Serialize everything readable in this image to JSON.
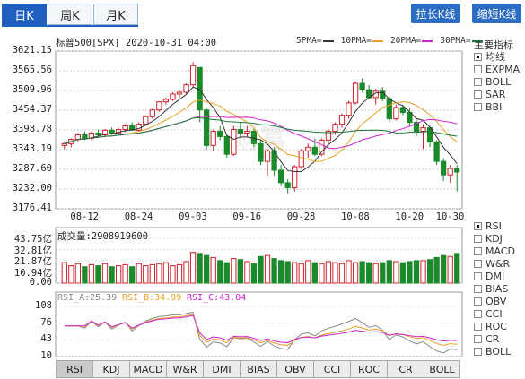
{
  "tabs": [
    {
      "label": "日K",
      "active": true
    },
    {
      "label": "周K",
      "active": false
    },
    {
      "label": "月K",
      "active": false
    }
  ],
  "buttons": {
    "stretch": "拉长K线",
    "shrink": "缩短K线"
  },
  "title": "标普500[SPX] 2020-10-31 04:00",
  "legend": [
    {
      "label": "5PMA=",
      "color": "#333333"
    },
    {
      "label": "10PMA=",
      "color": "#e8a020"
    },
    {
      "label": "20PMA=",
      "color": "#d020d0"
    },
    {
      "label": "30PMA=",
      "color": "#1a7a3a"
    }
  ],
  "side_main_title": "主要指标",
  "side_main": [
    {
      "label": "均线",
      "checked": true
    },
    {
      "label": "EXPMA",
      "checked": false
    },
    {
      "label": "BOLL",
      "checked": false
    },
    {
      "label": "SAR",
      "checked": false
    },
    {
      "label": "BBI",
      "checked": false
    }
  ],
  "side_sub": [
    {
      "label": "RSI",
      "checked": true
    },
    {
      "label": "KDJ",
      "checked": false
    },
    {
      "label": "MACD",
      "checked": false
    },
    {
      "label": "W&R",
      "checked": false
    },
    {
      "label": "DMI",
      "checked": false
    },
    {
      "label": "BIAS",
      "checked": false
    },
    {
      "label": "OBV",
      "checked": false
    },
    {
      "label": "CCI",
      "checked": false
    },
    {
      "label": "ROC",
      "checked": false
    },
    {
      "label": "CR",
      "checked": false
    },
    {
      "label": "BOLL",
      "checked": false
    }
  ],
  "volume_label": "成交量:2908919600",
  "rsi_label": {
    "a": "RSI_A:25.39",
    "b": "RSI_B:34.99",
    "c": "RSI_C:43.04"
  },
  "bottom_tabs": [
    "RSI",
    "KDJ",
    "MACD",
    "W&R",
    "DMI",
    "BIAS",
    "OBV",
    "CCI",
    "ROC",
    "CR",
    "BOLL"
  ],
  "watermark": "财富",
  "colors": {
    "up": "#d0202a",
    "down": "#1a8a2a",
    "ma5": "#333333",
    "ma10": "#e8a020",
    "ma20": "#d020d0",
    "ma30": "#1a7a3a"
  },
  "chart_data": [
    {
      "type": "candlestick",
      "title": "标普500[SPX] 2020-10-31 04:00",
      "y_ticks": [
        "3621.15",
        "3565.56",
        "3509.96",
        "3454.37",
        "3398.78",
        "3343.19",
        "3287.60",
        "3232.00",
        "3176.41"
      ],
      "ylim": [
        3176.41,
        3621.15
      ],
      "x_ticks": [
        "08-12",
        "08-24",
        "09-03",
        "09-16",
        "09-28",
        "10-08",
        "10-20",
        "10-30"
      ],
      "ohlc": [
        [
          3355,
          3365,
          3345,
          3360
        ],
        [
          3360,
          3375,
          3350,
          3372
        ],
        [
          3372,
          3390,
          3365,
          3385
        ],
        [
          3385,
          3395,
          3370,
          3375
        ],
        [
          3375,
          3395,
          3370,
          3390
        ],
        [
          3390,
          3400,
          3380,
          3385
        ],
        [
          3385,
          3402,
          3378,
          3398
        ],
        [
          3398,
          3405,
          3385,
          3390
        ],
        [
          3390,
          3405,
          3385,
          3400
        ],
        [
          3400,
          3415,
          3392,
          3410
        ],
        [
          3410,
          3420,
          3400,
          3398
        ],
        [
          3398,
          3420,
          3395,
          3415
        ],
        [
          3415,
          3440,
          3410,
          3436
        ],
        [
          3436,
          3460,
          3430,
          3455
        ],
        [
          3455,
          3480,
          3450,
          3478
        ],
        [
          3478,
          3490,
          3470,
          3485
        ],
        [
          3485,
          3505,
          3480,
          3500
        ],
        [
          3500,
          3510,
          3490,
          3505
        ],
        [
          3505,
          3530,
          3500,
          3526
        ],
        [
          3526,
          3590,
          3520,
          3580
        ],
        [
          3575,
          3576,
          3420,
          3455
        ],
        [
          3455,
          3460,
          3345,
          3355
        ],
        [
          3355,
          3400,
          3340,
          3395
        ],
        [
          3395,
          3410,
          3370,
          3380
        ],
        [
          3380,
          3385,
          3320,
          3330
        ],
        [
          3330,
          3410,
          3325,
          3400
        ],
        [
          3400,
          3420,
          3375,
          3390
        ],
        [
          3390,
          3410,
          3380,
          3395
        ],
        [
          3395,
          3405,
          3350,
          3360
        ],
        [
          3360,
          3370,
          3300,
          3310
        ],
        [
          3310,
          3345,
          3270,
          3340
        ],
        [
          3340,
          3350,
          3270,
          3285
        ],
        [
          3285,
          3300,
          3240,
          3250
        ],
        [
          3250,
          3260,
          3220,
          3236
        ],
        [
          3236,
          3300,
          3225,
          3295
        ],
        [
          3295,
          3345,
          3290,
          3340
        ],
        [
          3340,
          3360,
          3320,
          3350
        ],
        [
          3350,
          3375,
          3325,
          3330
        ],
        [
          3330,
          3375,
          3325,
          3370
        ],
        [
          3370,
          3400,
          3360,
          3395
        ],
        [
          3395,
          3420,
          3385,
          3415
        ],
        [
          3415,
          3445,
          3405,
          3440
        ],
        [
          3440,
          3480,
          3430,
          3475
        ],
        [
          3475,
          3535,
          3470,
          3530
        ],
        [
          3530,
          3545,
          3505,
          3512
        ],
        [
          3512,
          3525,
          3485,
          3490
        ],
        [
          3490,
          3515,
          3470,
          3508
        ],
        [
          3508,
          3520,
          3480,
          3487
        ],
        [
          3487,
          3495,
          3420,
          3430
        ],
        [
          3430,
          3470,
          3425,
          3462
        ],
        [
          3462,
          3470,
          3440,
          3448
        ],
        [
          3448,
          3460,
          3410,
          3420
        ],
        [
          3420,
          3430,
          3380,
          3395
        ],
        [
          3395,
          3415,
          3345,
          3405
        ],
        [
          3405,
          3410,
          3350,
          3365
        ],
        [
          3365,
          3370,
          3300,
          3310
        ],
        [
          3310,
          3320,
          3255,
          3272
        ],
        [
          3272,
          3300,
          3250,
          3290
        ],
        [
          3290,
          3300,
          3225,
          3280
        ]
      ],
      "series": [
        {
          "name": "5PMA",
          "color": "#333333"
        },
        {
          "name": "10PMA",
          "color": "#e8a020"
        },
        {
          "name": "20PMA",
          "color": "#d020d0"
        },
        {
          "name": "30PMA",
          "color": "#1a7a3a"
        }
      ]
    },
    {
      "type": "bar",
      "title": "成交量:2908919600",
      "y_ticks": [
        "43.75亿",
        "32.81亿",
        "21.87亿",
        "10.94亿",
        "0.00"
      ],
      "ylim": [
        0,
        43.75
      ],
      "values_yi": [
        20,
        17,
        19,
        16,
        18,
        17,
        19,
        16,
        17,
        18,
        16,
        19,
        17,
        18,
        19,
        20,
        17,
        18,
        21,
        30,
        29,
        27,
        25,
        22,
        20,
        24,
        23,
        21,
        19,
        26,
        27,
        24,
        22,
        21,
        20,
        19,
        22,
        20,
        19,
        21,
        20,
        19,
        22,
        20,
        21,
        20,
        19,
        20,
        22,
        21,
        20,
        21,
        22,
        22,
        23,
        25,
        27,
        26,
        29
      ]
    },
    {
      "type": "line",
      "title": "RSI",
      "y_ticks": [
        "108",
        "76",
        "43",
        "10"
      ],
      "ylim": [
        10,
        108
      ],
      "series": [
        {
          "name": "RSI_A",
          "color": "#666666",
          "value": 25.39
        },
        {
          "name": "RSI_B",
          "color": "#e8a020",
          "value": 34.99
        },
        {
          "name": "RSI_C",
          "color": "#d020d0",
          "value": 43.04
        }
      ]
    }
  ]
}
